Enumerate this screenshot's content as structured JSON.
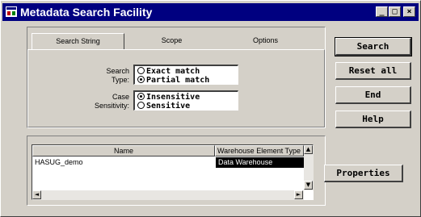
{
  "window": {
    "title": "Metadata Search Facility",
    "minimize_glyph": "_",
    "restore_glyph": "□",
    "close_glyph": "×"
  },
  "tabs": [
    {
      "label": "Search String",
      "active": true
    },
    {
      "label": "Scope",
      "active": false
    },
    {
      "label": "Options",
      "active": false
    }
  ],
  "search_type": {
    "label_line1": "Search",
    "label_line2": "Type:",
    "options": [
      {
        "label": "Exact match",
        "selected": false
      },
      {
        "label": "Partial match",
        "selected": true
      }
    ]
  },
  "case_sensitivity": {
    "label_line1": "Case",
    "label_line2": "Sensitivity:",
    "options": [
      {
        "label": "Insensitive",
        "selected": true
      },
      {
        "label": "Sensitive",
        "selected": false
      }
    ]
  },
  "buttons": {
    "search": "Search",
    "reset_all": "Reset all",
    "end": "End",
    "help": "Help",
    "properties": "Properties"
  },
  "results": {
    "columns": [
      "Name",
      "Warehouse Element Type"
    ],
    "rows": [
      {
        "name": "HASUG_demo",
        "type": "Data Warehouse",
        "selected": true
      }
    ]
  },
  "scroll_glyphs": {
    "up": "▲",
    "down": "▼",
    "left": "◄",
    "right": "►"
  },
  "colors": {
    "titlebar": "#000080",
    "face": "#d4d0c8",
    "selection": "#000000"
  }
}
